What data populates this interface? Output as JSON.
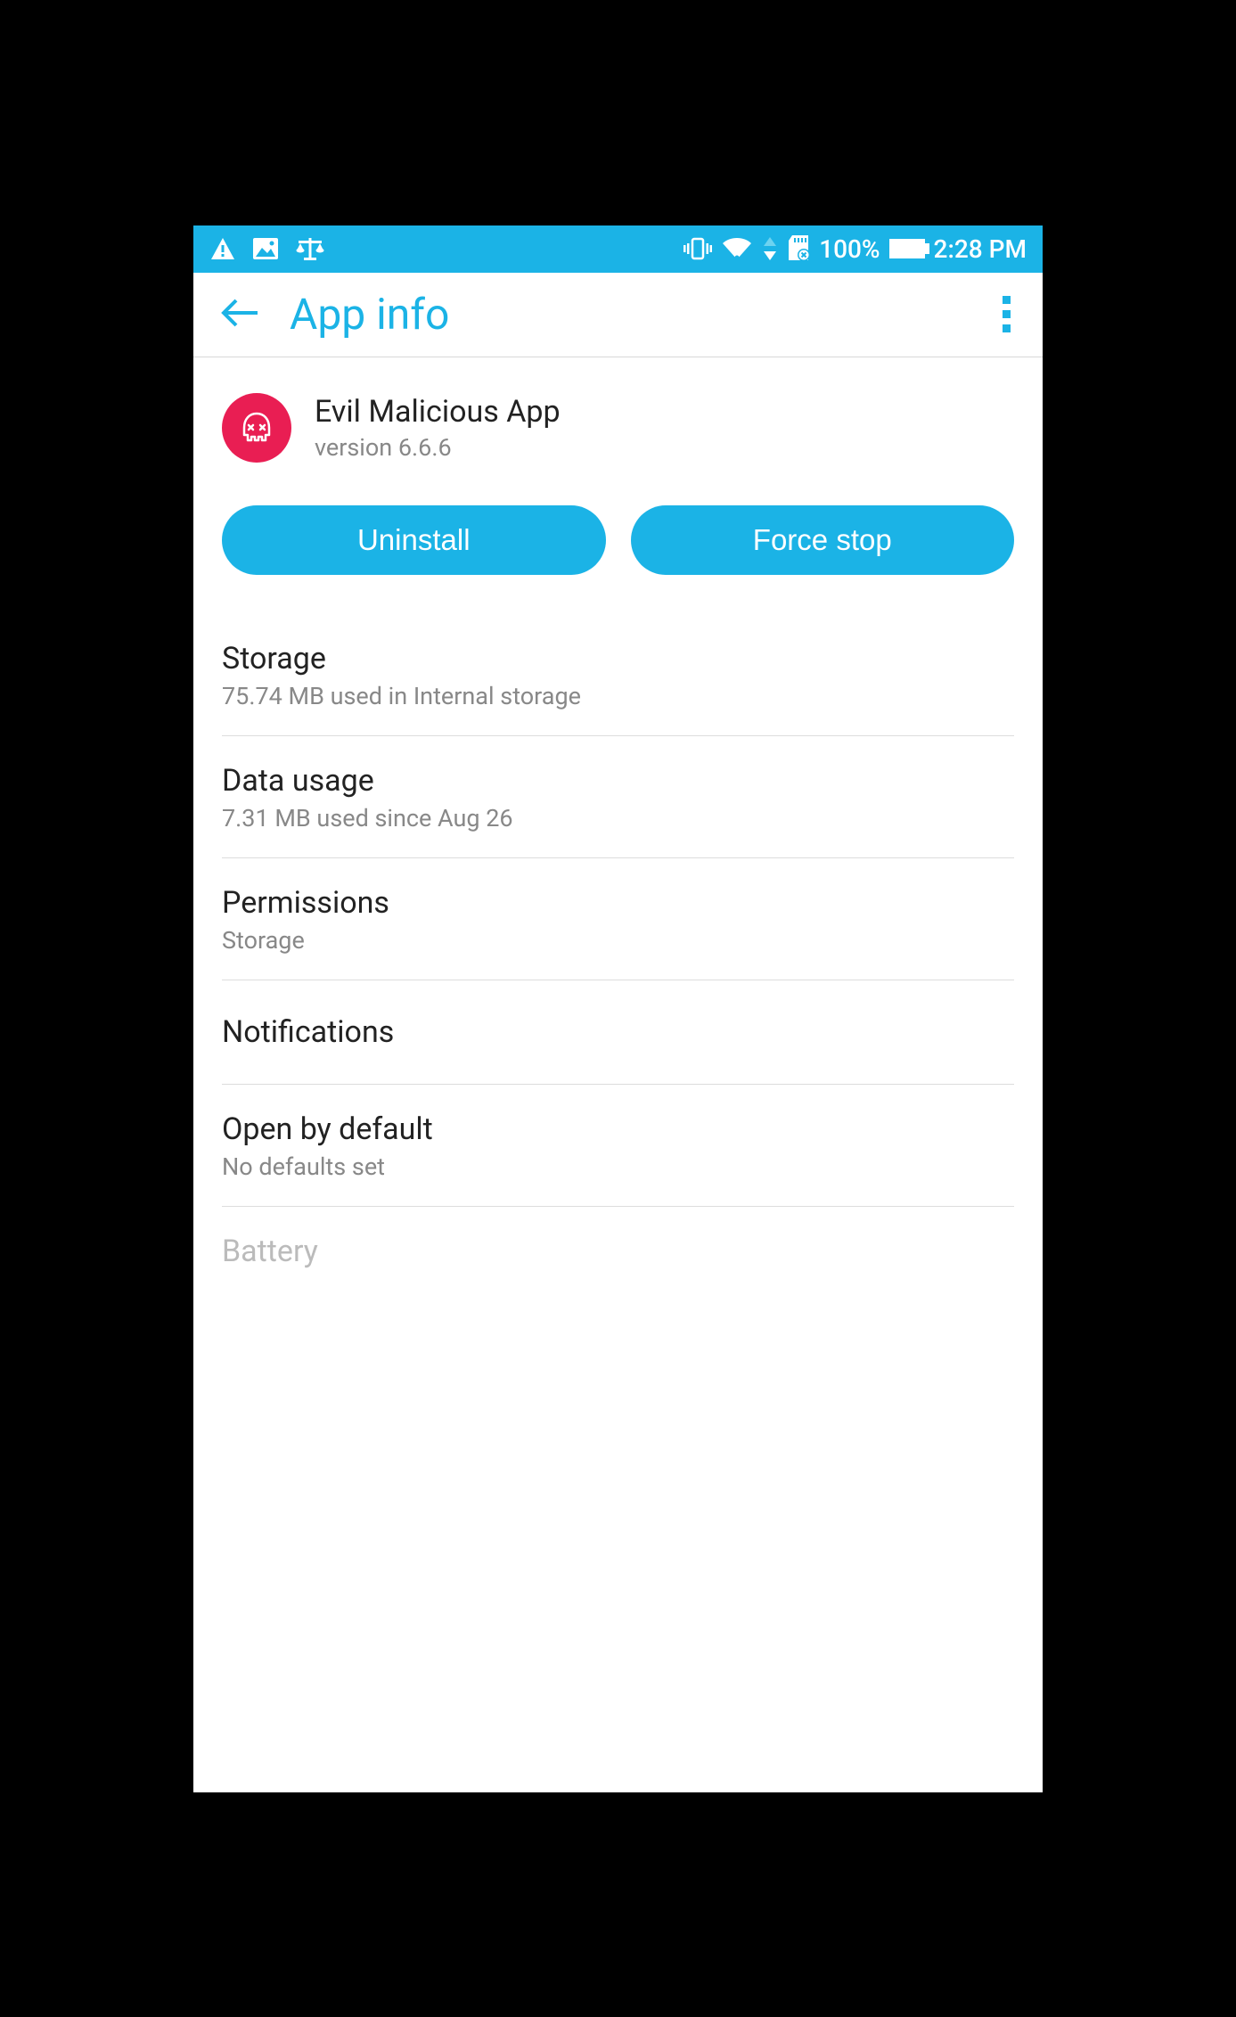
{
  "status_bar": {
    "battery_pct": "100%",
    "time": "2:28 PM"
  },
  "app_bar": {
    "title": "App info"
  },
  "app": {
    "name": "Evil Malicious App",
    "version": "version 6.6.6"
  },
  "buttons": {
    "uninstall": "Uninstall",
    "force_stop": "Force stop"
  },
  "items": [
    {
      "title": "Storage",
      "sub": "75.74 MB used in Internal storage"
    },
    {
      "title": "Data usage",
      "sub": "7.31 MB used since Aug 26"
    },
    {
      "title": "Permissions",
      "sub": "Storage"
    },
    {
      "title": "Notifications",
      "sub": ""
    },
    {
      "title": "Open by default",
      "sub": "No defaults set"
    },
    {
      "title": "Battery",
      "sub": ""
    }
  ]
}
